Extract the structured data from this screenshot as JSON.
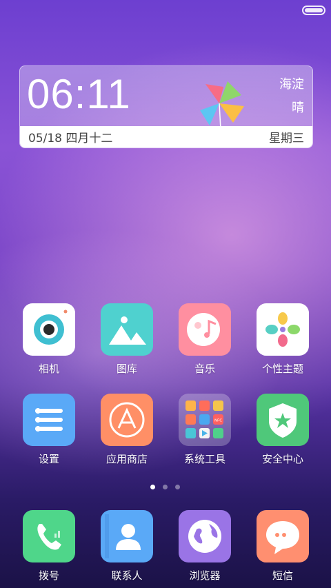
{
  "widget": {
    "time": "06:11",
    "location": "海淀",
    "weather": "晴",
    "date": "05/18 四月十二",
    "weekday": "星期三"
  },
  "apps": [
    {
      "label": "相机",
      "icon": "camera-icon"
    },
    {
      "label": "图库",
      "icon": "gallery-icon"
    },
    {
      "label": "音乐",
      "icon": "music-icon"
    },
    {
      "label": "个性主题",
      "icon": "themes-icon"
    },
    {
      "label": "设置",
      "icon": "settings-icon"
    },
    {
      "label": "应用商店",
      "icon": "app-store-icon"
    },
    {
      "label": "系统工具",
      "icon": "system-tools-folder-icon"
    },
    {
      "label": "安全中心",
      "icon": "security-center-icon"
    }
  ],
  "dock": [
    {
      "label": "拨号",
      "icon": "phone-icon"
    },
    {
      "label": "联系人",
      "icon": "contacts-icon"
    },
    {
      "label": "浏览器",
      "icon": "browser-icon"
    },
    {
      "label": "短信",
      "icon": "messages-icon"
    }
  ],
  "folder": {
    "nfc_label": "NFC"
  },
  "page_indicator": {
    "count": 3,
    "active": 0
  }
}
